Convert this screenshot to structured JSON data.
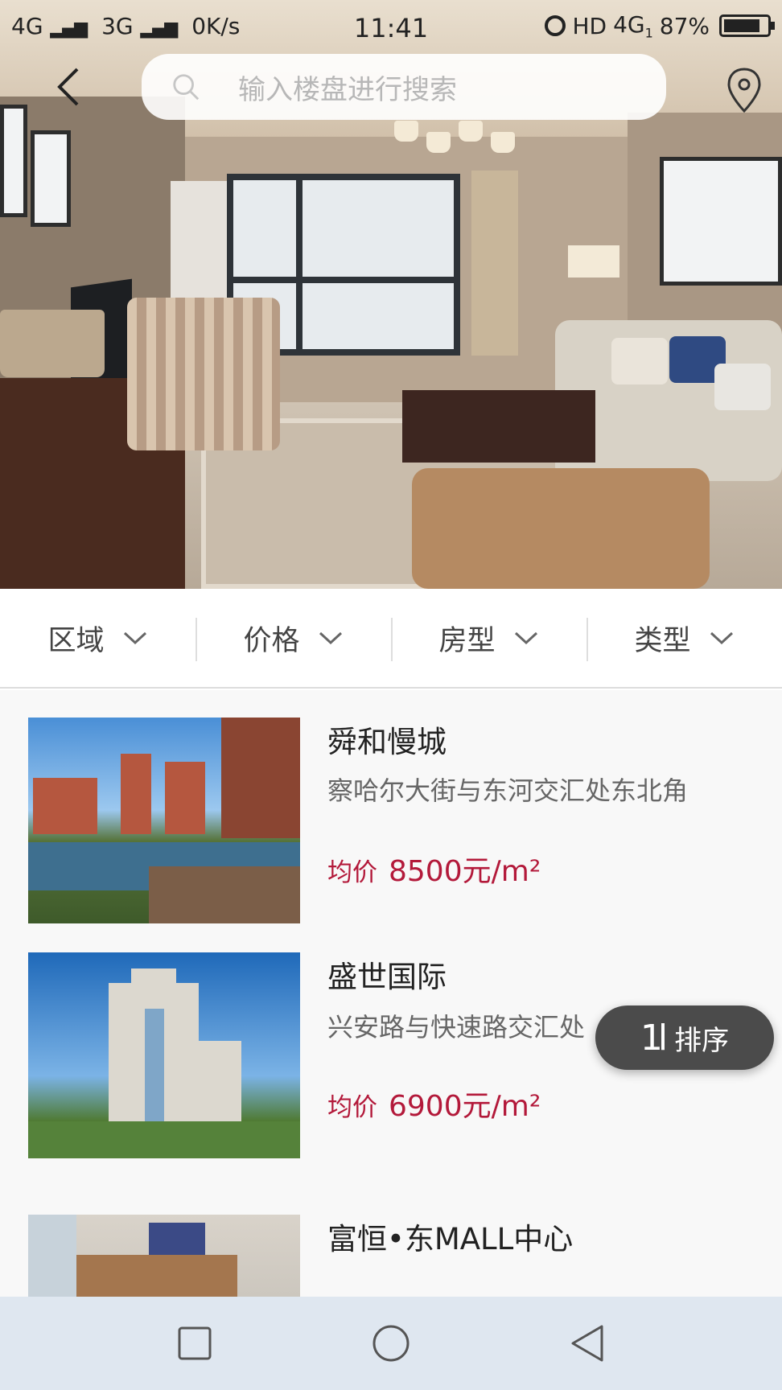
{
  "status_bar": {
    "signal_left": "4G",
    "signal_mid": "3G",
    "net_speed": "0K/s",
    "time": "11:41",
    "hd": "HD",
    "net_type": "4G",
    "net_sub": "1",
    "battery": "87%",
    "battery_level": 0.87
  },
  "header": {
    "search_placeholder": "输入楼盘进行搜索",
    "icons": {
      "back": "back-arrow-icon",
      "search": "search-icon",
      "location": "location-pin-icon"
    }
  },
  "filters": [
    {
      "label": "区域"
    },
    {
      "label": "价格"
    },
    {
      "label": "房型"
    },
    {
      "label": "类型"
    }
  ],
  "listings": [
    {
      "name": "舜和慢城",
      "address": "察哈尔大街与东河交汇处东北角",
      "price_label": "均价",
      "price": "8500元/m²"
    },
    {
      "name": "盛世国际",
      "address": "兴安路与快速路交汇处",
      "price_label": "均价",
      "price": "6900元/m²"
    },
    {
      "name": "富恒•东MALL中心"
    }
  ],
  "sort_button": {
    "icon": "1l",
    "label": "排序"
  },
  "colors": {
    "price": "#b3193a",
    "sort_bg": "#4b4b4b",
    "nav_bg": "#dfe7f0"
  },
  "navbar": {
    "icons": [
      "square-recent-icon",
      "circle-home-icon",
      "triangle-back-icon"
    ]
  }
}
